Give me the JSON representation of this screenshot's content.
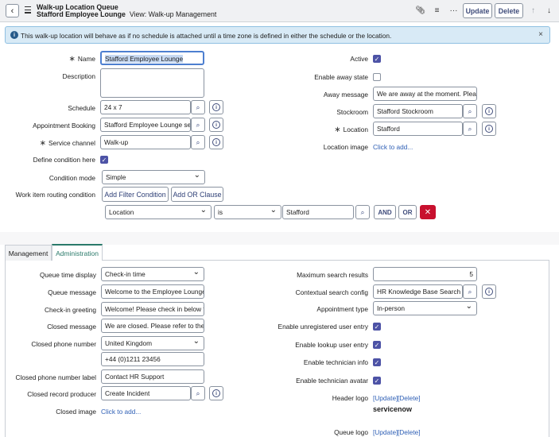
{
  "header": {
    "title": "Walk-up Location Queue",
    "record_name": "Stafford Employee Lounge",
    "view_label": "View: Walk-up Management",
    "update_label": "Update",
    "delete_label": "Delete"
  },
  "banner": {
    "text": "This walk-up location will behave as if no schedule is attached until a time zone is defined in either the schedule or the location."
  },
  "form": {
    "name": {
      "label": "Name",
      "value": "Stafford Employee Lounge"
    },
    "description": {
      "label": "Description",
      "value": ""
    },
    "schedule": {
      "label": "Schedule",
      "value": "24 x 7"
    },
    "appointment_booking": {
      "label": "Appointment Booking",
      "value": "Stafford Employee Lounge ser"
    },
    "service_channel": {
      "label": "Service channel",
      "value": "Walk-up"
    },
    "define_condition": {
      "label": "Define condition here",
      "checked": true
    },
    "condition_mode": {
      "label": "Condition mode",
      "value": "Simple"
    },
    "routing_condition": {
      "label": "Work item routing condition",
      "add_filter": "Add Filter Condition",
      "add_or": "Add OR Clause"
    },
    "condition_row": {
      "field": "Location",
      "operator": "is",
      "value": "Stafford",
      "and_label": "AND",
      "or_label": "OR"
    },
    "active": {
      "label": "Active",
      "checked": true
    },
    "enable_away": {
      "label": "Enable away state",
      "checked": false
    },
    "away_message": {
      "label": "Away message",
      "value": "We are away at the moment. Please"
    },
    "stockroom": {
      "label": "Stockroom",
      "value": "Stafford Stockroom"
    },
    "location": {
      "label": "Location",
      "value": "Stafford"
    },
    "location_image": {
      "label": "Location image",
      "link": "Click to add..."
    }
  },
  "tabs": [
    {
      "label": "Management"
    },
    {
      "label": "Administration"
    }
  ],
  "admin": {
    "queue_time_display": {
      "label": "Queue time display",
      "value": "Check-in time"
    },
    "queue_message": {
      "label": "Queue message",
      "value": "Welcome to the Employee Lounge"
    },
    "checkin_greeting": {
      "label": "Check-in greeting",
      "value": "Welcome! Please check in below to ."
    },
    "closed_message": {
      "label": "Closed message",
      "value": "We are closed. Please refer to the ho"
    },
    "closed_phone": {
      "label": "Closed phone number",
      "country": "United Kingdom",
      "number": "+44 (0)1211 23456"
    },
    "closed_phone_label": {
      "label": "Closed phone number label",
      "value": "Contact HR Support"
    },
    "closed_record_producer": {
      "label": "Closed record producer",
      "value": "Create Incident"
    },
    "closed_image": {
      "label": "Closed image",
      "link": "Click to add..."
    },
    "max_search": {
      "label": "Maximum search results",
      "value": "5"
    },
    "contextual_search": {
      "label": "Contextual search config",
      "value": "HR Knowledge Base Search"
    },
    "appointment_type": {
      "label": "Appointment type",
      "value": "In-person"
    },
    "unregistered": {
      "label": "Enable unregistered user entry",
      "checked": true
    },
    "lookup": {
      "label": "Enable lookup user entry",
      "checked": true
    },
    "tech_info": {
      "label": "Enable technician info",
      "checked": true
    },
    "tech_avatar": {
      "label": "Enable technician avatar",
      "checked": true
    },
    "header_logo": {
      "label": "Header logo",
      "update": "[Update]",
      "delete": "[Delete]",
      "logo_text": "servicenow"
    },
    "queue_logo": {
      "label": "Queue logo",
      "update": "[Update]",
      "delete": "[Delete]"
    }
  },
  "colors": {
    "accent": "#4d53a6",
    "brand_text": "#3f4c7b",
    "banner_bg": "#d8eaf6",
    "tab_active": "#2a7a6a",
    "danger": "#c8102e"
  }
}
